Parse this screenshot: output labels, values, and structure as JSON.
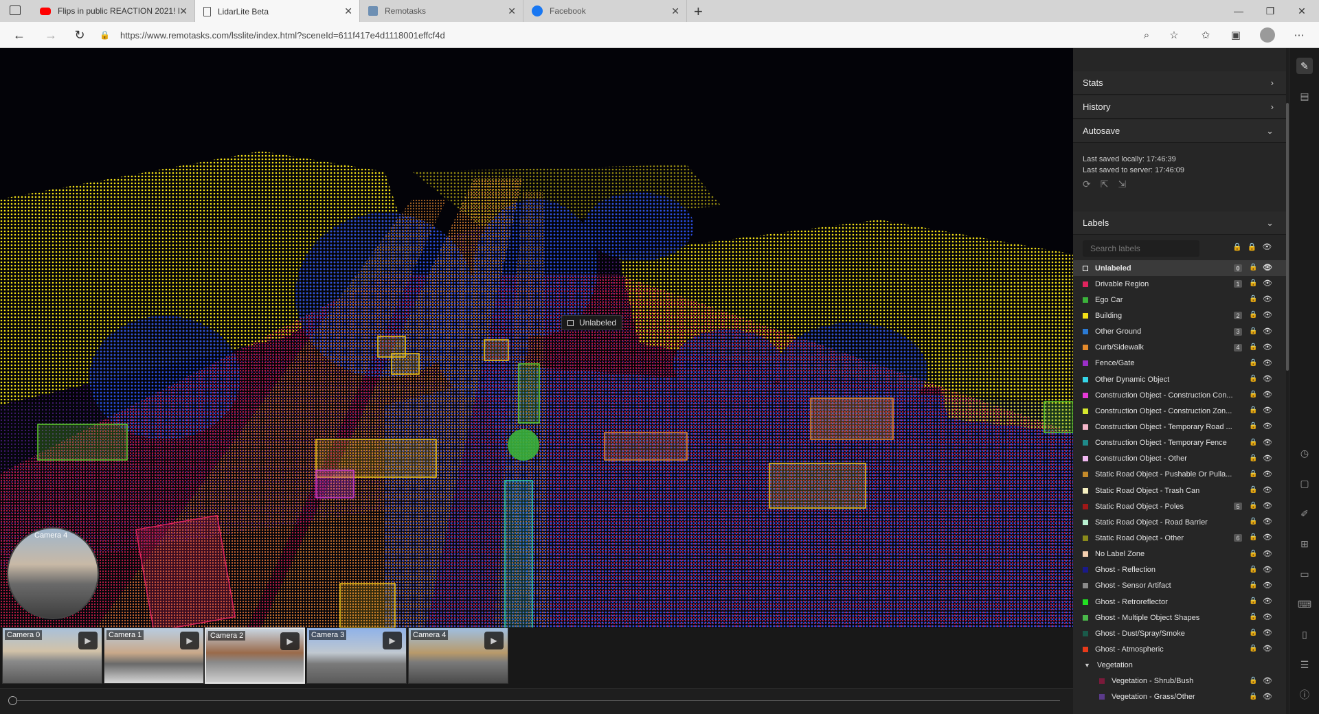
{
  "browser": {
    "tabs": [
      {
        "title": "Flips in public REACTION 2021! I",
        "icon": "youtube-icon",
        "color": "#ff0000"
      },
      {
        "title": "LidarLite Beta",
        "icon": "page-icon",
        "color": "#555555"
      },
      {
        "title": "Remotasks",
        "icon": "remotasks-icon",
        "color": "#6d8fb3"
      },
      {
        "title": "Facebook",
        "icon": "facebook-icon",
        "color": "#1877f2"
      }
    ],
    "url": "https://www.remotasks.com/lsslite/index.html?sceneId=611f417e4d1118001effcf4d"
  },
  "viewport": {
    "hover_label": "Unlabeled",
    "camera_bubble_label": "Camera 4"
  },
  "cameras": [
    {
      "label": "Camera 0"
    },
    {
      "label": "Camera 1"
    },
    {
      "label": "Camera 2"
    },
    {
      "label": "Camera 3"
    },
    {
      "label": "Camera 4"
    }
  ],
  "panel": {
    "sections": {
      "stats": "Stats",
      "history": "History",
      "autosave": "Autosave",
      "labels": "Labels"
    },
    "autosave": {
      "local": "Last saved locally: 17:46:39",
      "server": "Last saved to server: 17:46:09"
    },
    "search_placeholder": "Search labels",
    "labels": [
      {
        "name": "Unlabeled",
        "color": "#ffffff",
        "count": "0",
        "selected": true
      },
      {
        "name": "Drivable Region",
        "color": "#e0245e",
        "count": "1"
      },
      {
        "name": "Ego Car",
        "color": "#3bb33b",
        "count": ""
      },
      {
        "name": "Building",
        "color": "#f2e017",
        "count": "2"
      },
      {
        "name": "Other Ground",
        "color": "#2b7bd4",
        "count": "3"
      },
      {
        "name": "Curb/Sidewalk",
        "color": "#e58a2b",
        "count": "4"
      },
      {
        "name": "Fence/Gate",
        "color": "#9b2fc9",
        "count": ""
      },
      {
        "name": "Other Dynamic Object",
        "color": "#35d6e8",
        "count": ""
      },
      {
        "name": "Construction Object - Construction Con...",
        "color": "#e83ad8",
        "count": ""
      },
      {
        "name": "Construction Object - Construction Zon...",
        "color": "#d6e82e",
        "count": ""
      },
      {
        "name": "Construction Object - Temporary Road ...",
        "color": "#f4b6c9",
        "count": ""
      },
      {
        "name": "Construction Object - Temporary Fence",
        "color": "#1f8a8a",
        "count": ""
      },
      {
        "name": "Construction Object - Other",
        "color": "#f0b8f0",
        "count": ""
      },
      {
        "name": "Static Road Object - Pushable Or Pulla...",
        "color": "#c48a2a",
        "count": ""
      },
      {
        "name": "Static Road Object - Trash Can",
        "color": "#f5efc0",
        "count": ""
      },
      {
        "name": "Static Road Object - Poles",
        "color": "#a01818",
        "count": "5"
      },
      {
        "name": "Static Road Object - Road Barrier",
        "color": "#b8f0d0",
        "count": ""
      },
      {
        "name": "Static Road Object - Other",
        "color": "#8a8a1a",
        "count": "6"
      },
      {
        "name": "No Label Zone",
        "color": "#f5d0b0",
        "count": ""
      },
      {
        "name": "Ghost - Reflection",
        "color": "#1a1a8a",
        "count": ""
      },
      {
        "name": "Ghost - Sensor Artifact",
        "color": "#8a8a8a",
        "count": ""
      },
      {
        "name": "Ghost - Retroreflector",
        "color": "#22e022",
        "count": ""
      },
      {
        "name": "Ghost - Multiple Object Shapes",
        "color": "#4ab84a",
        "count": ""
      },
      {
        "name": "Ghost - Dust/Spray/Smoke",
        "color": "#1a5a4a",
        "count": ""
      },
      {
        "name": "Ghost - Atmospheric",
        "color": "#e83a1a",
        "count": ""
      }
    ],
    "group": {
      "name": "Vegetation"
    },
    "sub_labels": [
      {
        "name": "Vegetation - Shrub/Bush",
        "color": "#7a1a3a"
      },
      {
        "name": "Vegetation - Grass/Other",
        "color": "#5a3a8a"
      }
    ]
  }
}
